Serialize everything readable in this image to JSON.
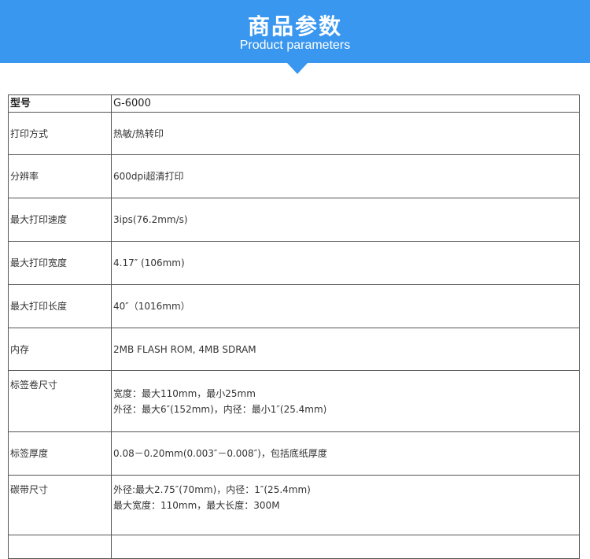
{
  "header": {
    "title": "商品参数",
    "subtitle": "Product parameters",
    "accent_color": "#3a97f0"
  },
  "table": {
    "rows": [
      {
        "label": "型号",
        "value": [
          "G-6000"
        ]
      },
      {
        "label": "打印方式",
        "value": [
          "热敏/热转印"
        ]
      },
      {
        "label": "分辨率",
        "value": [
          "600dpi超清打印"
        ]
      },
      {
        "label": "最大打印速度",
        "value": [
          "3ips(76.2mm/s)"
        ]
      },
      {
        "label": "最大打印宽度",
        "value": [
          "4.17″ (106mm)"
        ]
      },
      {
        "label": "最大打印长度",
        "value": [
          "40″（1016mm）"
        ]
      },
      {
        "label": "内存",
        "value": [
          "2MB FLASH ROM, 4MB SDRAM"
        ]
      },
      {
        "label": "标签卷尺寸",
        "value": [
          "宽度：最大110mm，最小25mm",
          "外径：最大6″(152mm)，内径：最小1″(25.4mm)"
        ]
      },
      {
        "label": "标签厚度",
        "value": [
          "0.08－0.20mm(0.003″－0.008″)，包括底纸厚度"
        ]
      },
      {
        "label": "碳带尺寸",
        "value": [
          "外径:最大2.75″(70mm)，内径：1″(25.4mm)",
          "最大宽度：110mm，最大长度：300M"
        ]
      }
    ]
  }
}
